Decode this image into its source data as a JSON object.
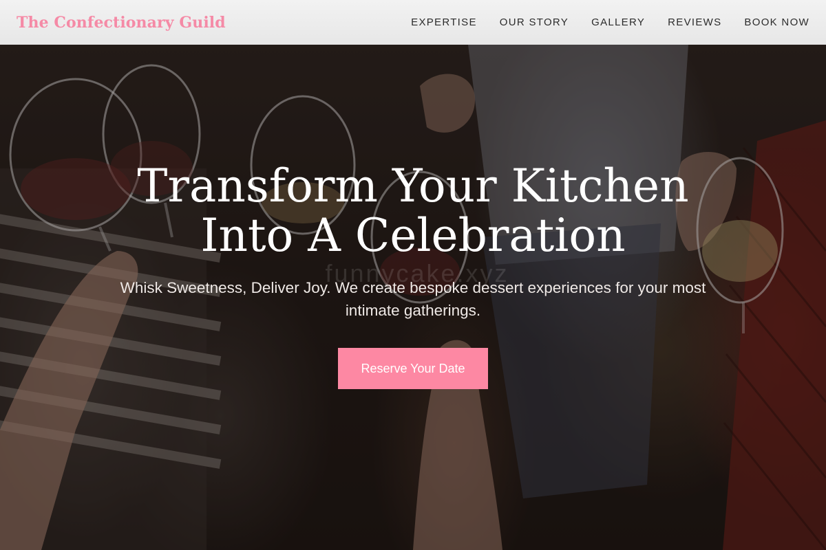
{
  "header": {
    "brand": "The Confectionary Guild",
    "nav": [
      {
        "label": "EXPERTISE"
      },
      {
        "label": "OUR STORY"
      },
      {
        "label": "GALLERY"
      },
      {
        "label": "REVIEWS"
      },
      {
        "label": "BOOK NOW"
      }
    ]
  },
  "hero": {
    "title_line1": "Transform Your Kitchen",
    "title_line2": "Into A Celebration",
    "subtitle": "Whisk Sweetness, Deliver Joy. We create bespoke dessert experiences for your most intimate gatherings.",
    "cta_label": "Reserve Your Date",
    "watermark": "funnycake.xyz",
    "background_image": "people toasting with wine glasses"
  },
  "colors": {
    "brand_pink": "#f58aa6",
    "cta_pink": "#fd88a3",
    "header_bg": "#eeeeee",
    "nav_text": "#2b2b2b"
  }
}
